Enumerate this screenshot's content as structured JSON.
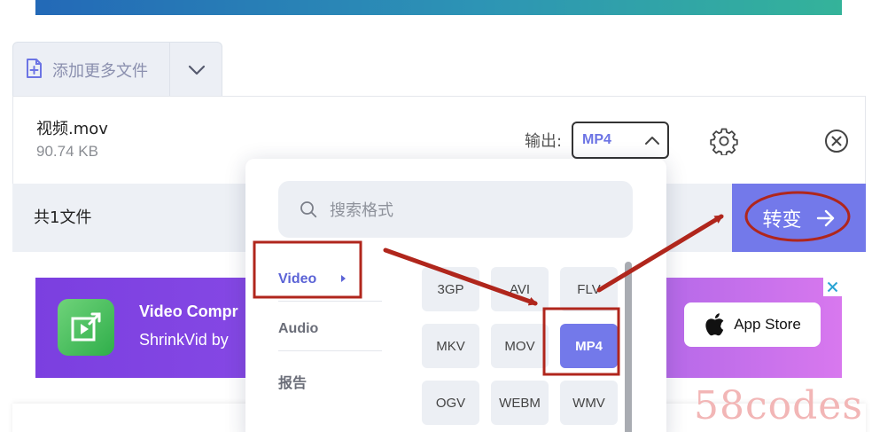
{
  "header": {
    "add_files_label": "添加更多文件"
  },
  "file": {
    "name": "视频.mov",
    "size": "90.74 KB",
    "output_label": "输出:",
    "output_format": "MP4"
  },
  "summary": {
    "total_label": "共1文件",
    "convert_label": "转变"
  },
  "format_menu": {
    "search_placeholder": "搜索格式",
    "categories": [
      {
        "label": "Video",
        "active": true
      },
      {
        "label": "Audio",
        "active": false
      },
      {
        "label": "报告",
        "active": false
      }
    ],
    "formats": [
      [
        "3GP",
        "AVI",
        "FLV"
      ],
      [
        "MKV",
        "MOV",
        "MP4"
      ],
      [
        "OGV",
        "WEBM",
        "WMV"
      ]
    ],
    "selected_format": "MP4"
  },
  "ad": {
    "title": "Video Compr",
    "subtitle": "ShrinkVid by",
    "store_label": "App Store"
  },
  "watermark": "58codes",
  "colors": {
    "accent": "#7379ea",
    "accent_text": "#6c74e4",
    "annotation_red": "#b0261c",
    "ad_purple": "#8a4ce6"
  }
}
